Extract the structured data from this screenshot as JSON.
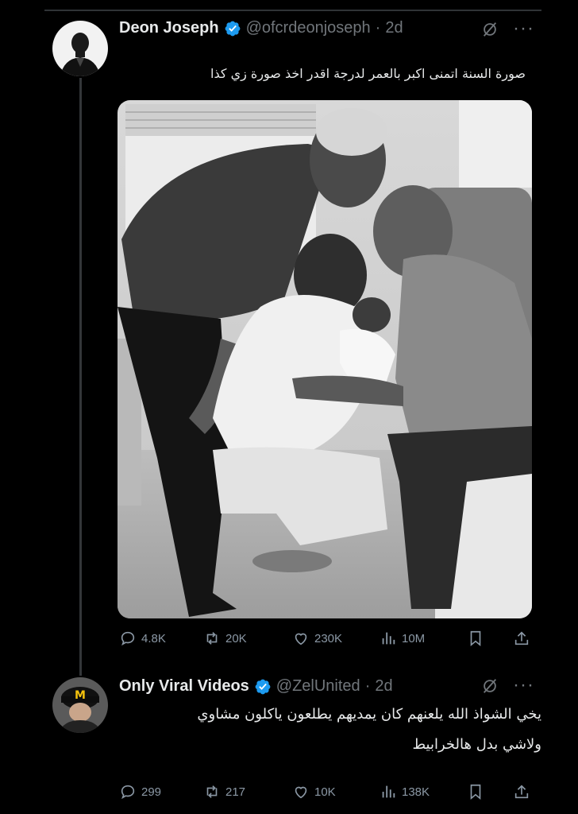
{
  "tweet": {
    "author_name": "Deon Joseph",
    "handle": "@ofcrdeonjoseph",
    "separator": "·",
    "time": "2d",
    "text": "صورة السنة اتمنى اكبر بالعمر لدرجة اقدر اخذ صورة زي كذا",
    "replies": "4.8K",
    "reposts": "20K",
    "likes": "230K",
    "views": "10M"
  },
  "reply": {
    "author_name": "Only Viral Videos",
    "handle": "@ZelUnited",
    "separator": "·",
    "time": "2d",
    "text_line1": "يخي الشواذ الله يلعنهم كان يمديهم يطلعون ياكلون مشاوي",
    "text_line2": "ولاشي بدل هالخرابيط",
    "replies": "299",
    "reposts": "217",
    "likes": "10K",
    "views": "138K"
  },
  "colors": {
    "background": "#000000",
    "text": "#e7e9ea",
    "muted": "#71767b",
    "verified": "#1d9bf0"
  },
  "icons": [
    "verified-badge-icon",
    "grok-icon",
    "more-icon",
    "reply-icon",
    "repost-icon",
    "like-icon",
    "views-icon",
    "bookmark-icon",
    "share-icon"
  ]
}
